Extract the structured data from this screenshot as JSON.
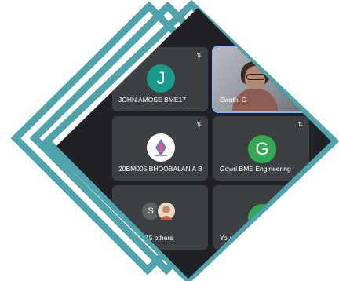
{
  "colors": {
    "frame_teal": "#4fa3ab",
    "screen_bg": "#202124",
    "tile_bg": "#3c4043",
    "john_avatar": "#1a9a8a",
    "gowri_avatar": "#34a853",
    "you_avatar": "#34a853",
    "s_avatar": "#5f6368"
  },
  "tiles": [
    {
      "name": "JOHN AMOSE BME17",
      "avatar_letter": "J",
      "pin_icon": "pin-icon"
    },
    {
      "name": "Swathi G",
      "type": "video",
      "pin_icon": "pin-icon"
    },
    {
      "name": "20BM005 BHOOBALAN A B",
      "type": "logo",
      "pin_icon": "pin-icon"
    },
    {
      "name": "Gowri BME Engineering",
      "avatar_letter": "G",
      "pin_icon": "pin-icon"
    },
    {
      "name": "15 others",
      "avatar_letter": "S"
    },
    {
      "name": "You"
    }
  ]
}
